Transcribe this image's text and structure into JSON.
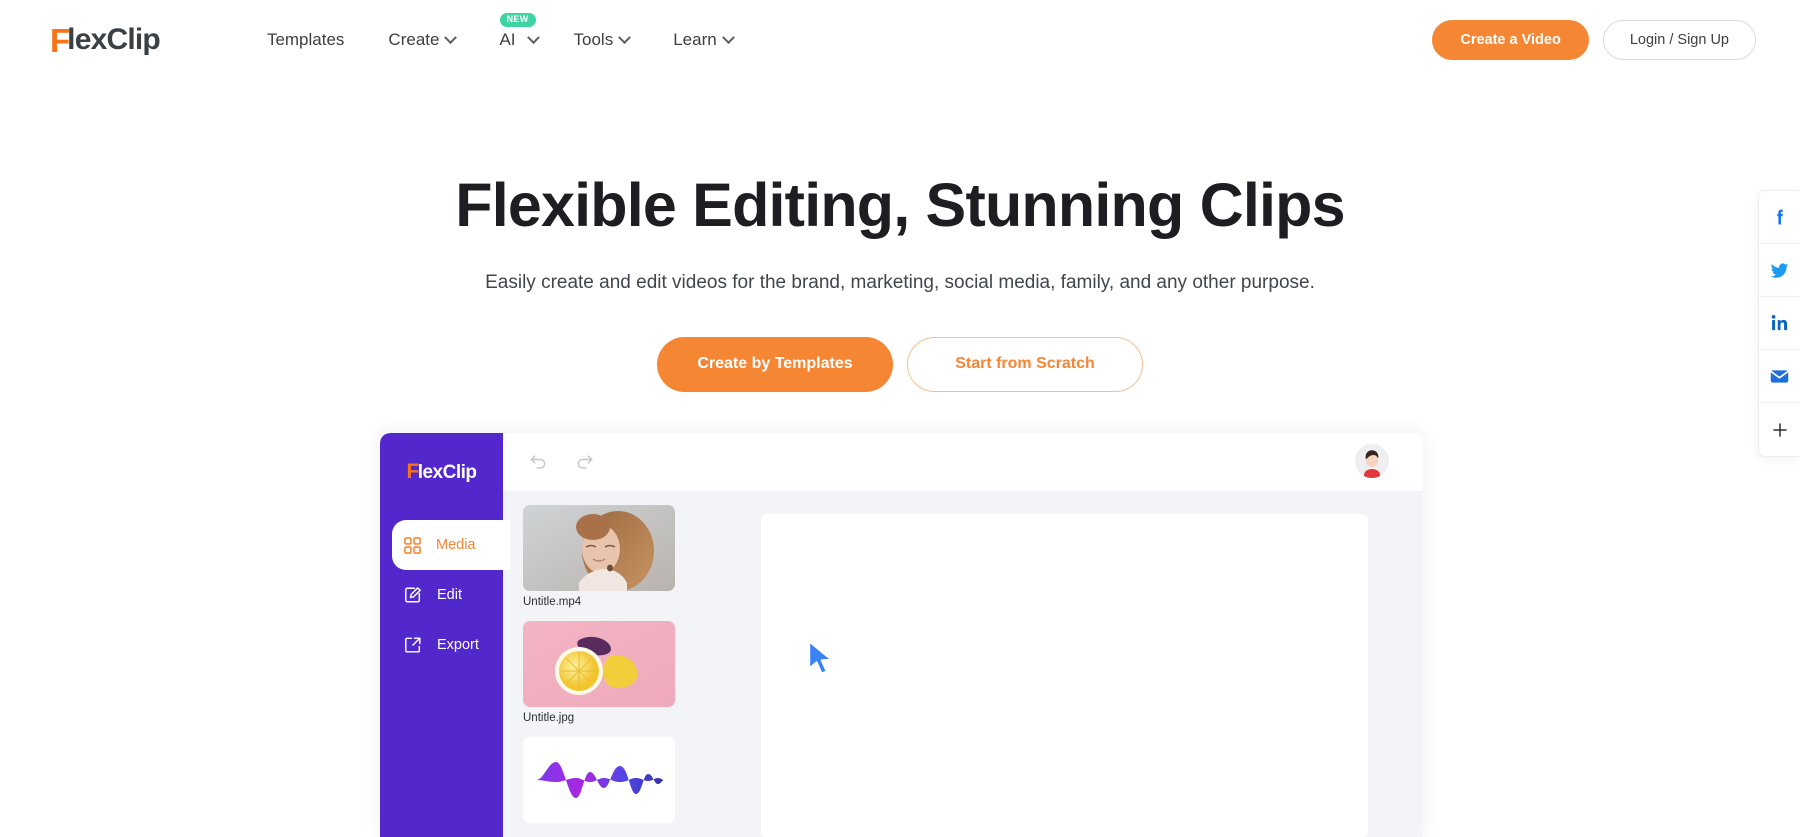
{
  "brand": {
    "logo_initial": "F",
    "logo_text": "lexClip"
  },
  "nav": {
    "items": [
      {
        "label": "Templates",
        "has_dropdown": false,
        "badge": ""
      },
      {
        "label": "Create",
        "has_dropdown": true,
        "badge": ""
      },
      {
        "label": "AI",
        "has_dropdown": true,
        "badge": "NEW"
      },
      {
        "label": "Tools",
        "has_dropdown": true,
        "badge": ""
      },
      {
        "label": "Learn",
        "has_dropdown": true,
        "badge": ""
      }
    ],
    "create_video_label": "Create a Video",
    "login_label": "Login / Sign Up"
  },
  "hero": {
    "title": "Flexible Editing, Stunning Clips",
    "subtitle": "Easily create and edit videos for the brand, marketing, social media, family, and any other purpose.",
    "primary_cta": "Create by Templates",
    "secondary_cta": "Start from Scratch"
  },
  "mockup": {
    "brand_initial": "F",
    "brand_text": "lexClip",
    "toolbar": {
      "undo": "undo-icon",
      "redo": "redo-icon",
      "avatar": "user-avatar"
    },
    "menu": [
      {
        "label": "Media",
        "icon": "grid-icon",
        "active": true
      },
      {
        "label": "Edit",
        "icon": "pencil-square-icon",
        "active": false
      },
      {
        "label": "Export",
        "icon": "export-arrow-icon",
        "active": false
      }
    ],
    "media": [
      {
        "name": "Untitle.mp4",
        "type": "video"
      },
      {
        "name": "Untitle.jpg",
        "type": "image"
      },
      {
        "name": "",
        "type": "audio"
      }
    ]
  },
  "social_rail": {
    "items": [
      {
        "name": "facebook-icon",
        "label": "f"
      },
      {
        "name": "twitter-icon",
        "label": ""
      },
      {
        "name": "linkedin-icon",
        "label": "in"
      },
      {
        "name": "email-icon",
        "label": ""
      },
      {
        "name": "plus-icon",
        "label": "+"
      }
    ]
  },
  "colors": {
    "brand_orange": "#F58634",
    "logo_orange": "#F97316",
    "badge_green": "#3ED3A3",
    "editor_purple": "#5227CC",
    "page_bg": "#FFFFFF",
    "mock_bg": "#F2F4F8"
  }
}
